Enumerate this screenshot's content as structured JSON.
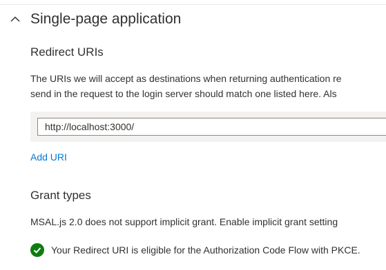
{
  "section": {
    "title": "Single-page application",
    "collapse_icon": "chevron-up-icon"
  },
  "redirect": {
    "heading": "Redirect URIs",
    "description_line1": "The URIs we will accept as destinations when returning authentication re",
    "description_line2": "send in the request to the login server should match one listed here. Als",
    "uri_value": "http://localhost:3000/",
    "add_uri_label": "Add URI"
  },
  "grant": {
    "heading": "Grant types",
    "description": "MSAL.js 2.0 does not support implicit grant. Enable implicit grant setting",
    "status_text": "Your Redirect URI is eligible for the Authorization Code Flow with PKCE.",
    "status_icon": "check-circle-icon"
  },
  "colors": {
    "accent": "#0078d4",
    "success": "#107c10",
    "text": "#323130",
    "row_background": "#f3f2f1"
  }
}
